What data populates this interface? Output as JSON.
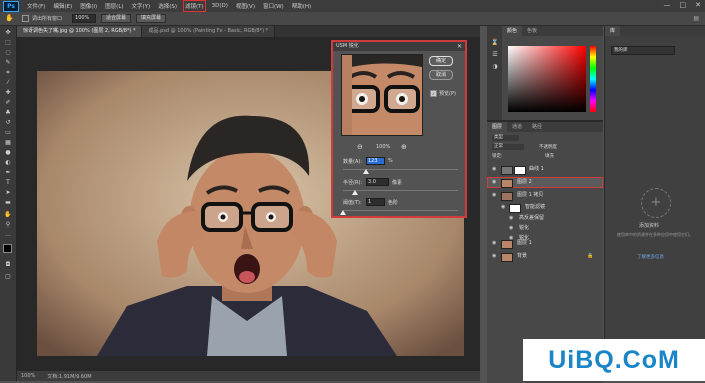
{
  "app": {
    "logo": "Ps"
  },
  "menu": [
    "文件(F)",
    "编辑(E)",
    "图像(I)",
    "图层(L)",
    "文字(Y)",
    "选择(S)",
    "滤镜(T)",
    "3D(D)",
    "视图(V)",
    "窗口(W)",
    "帮助(H)"
  ],
  "window_controls": {
    "minimize": "—",
    "maximize": "□",
    "close": "✕"
  },
  "options": {
    "checkbox_label": "调出所有窗口",
    "zoom_value": "100%",
    "fit_button": "适合屏幕",
    "fill_button": "填充屏幕"
  },
  "tabs": [
    {
      "label": "惊讶调色失了嘴.jpg @ 100% (图层 2, RGB/8*) *"
    },
    {
      "label": "成品.psd @ 100% (Painting Fx - Basic, RGB/8*) *"
    }
  ],
  "status": {
    "zoom": "100%",
    "doc": "文档:1.91M/9.60M"
  },
  "dialog": {
    "title": "USM 锐化",
    "close": "✕",
    "ok": "确定",
    "cancel": "取消",
    "preview_check": "✓",
    "preview_label": "预览(P)",
    "zoom_out": "⊖",
    "zoom_in": "⊕",
    "zoom_value": "100%",
    "amount_label": "数量(A):",
    "amount_value": "123",
    "amount_unit": "%",
    "amount_level": 0.2,
    "radius_label": "半径(R):",
    "radius_value": "3.0",
    "radius_unit": "像素",
    "radius_level": 0.1,
    "threshold_label": "阈值(T):",
    "threshold_value": "1",
    "threshold_unit": "色阶",
    "threshold_level": 0.0
  },
  "color_panel": {
    "tabs": [
      "颜色",
      "色板"
    ]
  },
  "layers_panel": {
    "tabs": [
      "图层",
      "通道",
      "路径"
    ],
    "filter_label": "类型",
    "blend_label": "正常",
    "opacity_label": "不透明度",
    "lock_label": "锁定:",
    "fill_label": "填充",
    "layers": [
      {
        "name": "曲线 1",
        "type": "adjust"
      },
      {
        "name": "图层 2",
        "type": "image",
        "selected": true
      },
      {
        "name": "图层 1 拷贝",
        "type": "smart"
      },
      {
        "name": "智能滤镜",
        "type": "sub"
      },
      {
        "name": "高反差保留",
        "type": "filter"
      },
      {
        "name": "锐化",
        "type": "filter"
      },
      {
        "name": "锐化",
        "type": "filter"
      },
      {
        "name": "图层 1",
        "type": "image"
      },
      {
        "name": "背景",
        "type": "image",
        "locked": true
      }
    ]
  },
  "libraries": {
    "dropdown": "我的库",
    "heading": "库",
    "empty_title": "添加资料",
    "empty_text": "使用库中的资源并在多种应用中使用它们。",
    "link": "了解更多信息"
  },
  "watermark": "UiBQ.CoM"
}
